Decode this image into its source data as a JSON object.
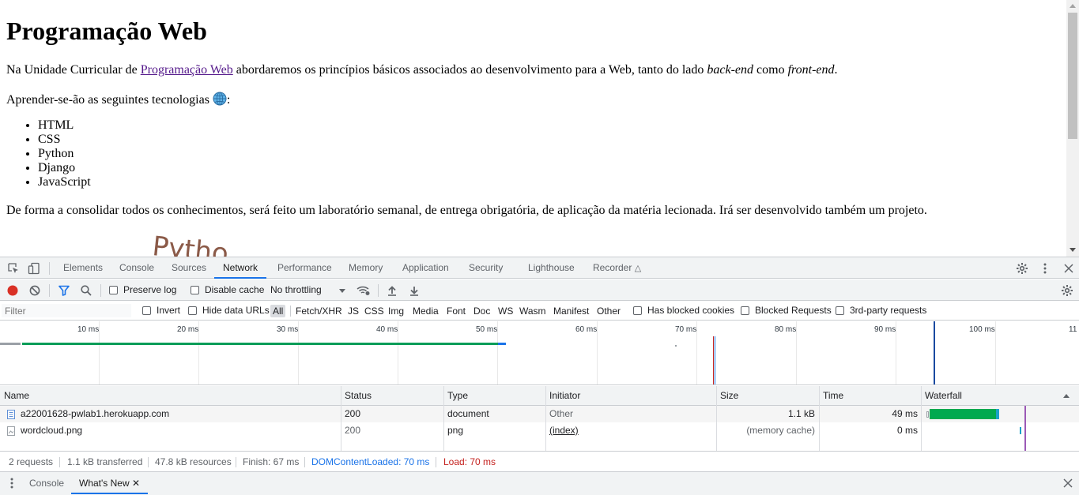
{
  "page": {
    "heading": "Programação Web",
    "intro_before": "Na Unidade Curricular de ",
    "intro_link": "Programação Web",
    "intro_middle": " abordaremos os princípios básicos associados ao desenvolvimento para a Web, tanto do lado ",
    "intro_backend": "back-end",
    "intro_como": " como ",
    "intro_frontend": "front-end",
    "intro_end": ".",
    "tech_intro": "Aprender-se-ão as seguintes tecnologias ",
    "tech_colon": ":",
    "technologies": [
      "HTML",
      "CSS",
      "Python",
      "Django",
      "JavaScript"
    ],
    "summary": "De forma a consolidar todos os conhecimentos, será feito um laboratório semanal, de entrega obrigatória, de aplicação da matéria lecionada. Irá ser desenvolvido também um projeto.",
    "wordcloud_partial": "Pytho"
  },
  "devtools": {
    "tabs": [
      "Elements",
      "Console",
      "Sources",
      "Network",
      "Performance",
      "Memory",
      "Application",
      "Security",
      "Lighthouse",
      "Recorder"
    ],
    "active_tab": "Network",
    "toolbar": {
      "preserve_log": "Preserve log",
      "disable_cache": "Disable cache",
      "throttling": "No throttling"
    },
    "filter": {
      "placeholder": "Filter",
      "invert": "Invert",
      "hide_data_urls": "Hide data URLs",
      "types": [
        "All",
        "Fetch/XHR",
        "JS",
        "CSS",
        "Img",
        "Media",
        "Font",
        "Doc",
        "WS",
        "Wasm",
        "Manifest",
        "Other"
      ],
      "selected_type": "All",
      "has_blocked_cookies": "Has blocked cookies",
      "blocked_requests": "Blocked Requests",
      "third_party": "3rd-party requests"
    },
    "timeline_ticks": [
      "10 ms",
      "20 ms",
      "30 ms",
      "40 ms",
      "50 ms",
      "60 ms",
      "70 ms",
      "80 ms",
      "90 ms",
      "100 ms",
      "11"
    ],
    "table": {
      "columns": [
        "Name",
        "Status",
        "Type",
        "Initiator",
        "Size",
        "Time",
        "Waterfall"
      ],
      "rows": [
        {
          "name": "a22001628-pwlab1.herokuapp.com",
          "status": "200",
          "type": "document",
          "initiator": "Other",
          "size": "1.1 kB",
          "time": "49 ms"
        },
        {
          "name": "wordcloud.png",
          "status": "200",
          "type": "png",
          "initiator": "(index)",
          "size": "(memory cache)",
          "time": "0 ms"
        }
      ]
    },
    "status": {
      "requests": "2 requests",
      "transferred": "1.1 kB transferred",
      "resources": "47.8 kB resources",
      "finish": "Finish: 67 ms",
      "dom_loaded": "DOMContentLoaded: 70 ms",
      "load": "Load: 70 ms"
    },
    "drawer": {
      "tabs": [
        "Console",
        "What's New"
      ],
      "active_tab": "What's New"
    }
  },
  "colors": {
    "link_visited": "#551a8b",
    "accent": "#1a73e8",
    "record": "#d93025",
    "waterfall_green": "#00a94f",
    "dom_loaded": "#1a73e8",
    "load": "#c5221f"
  },
  "icons": [
    "inspect-icon",
    "device-toggle-icon",
    "settings-gear-icon",
    "kebab-menu-icon",
    "close-icon",
    "record-icon",
    "clear-icon",
    "filter-icon",
    "search-icon",
    "network-conditions-icon",
    "import-har-icon",
    "export-har-icon",
    "globe-icon",
    "document-icon",
    "image-file-icon"
  ]
}
